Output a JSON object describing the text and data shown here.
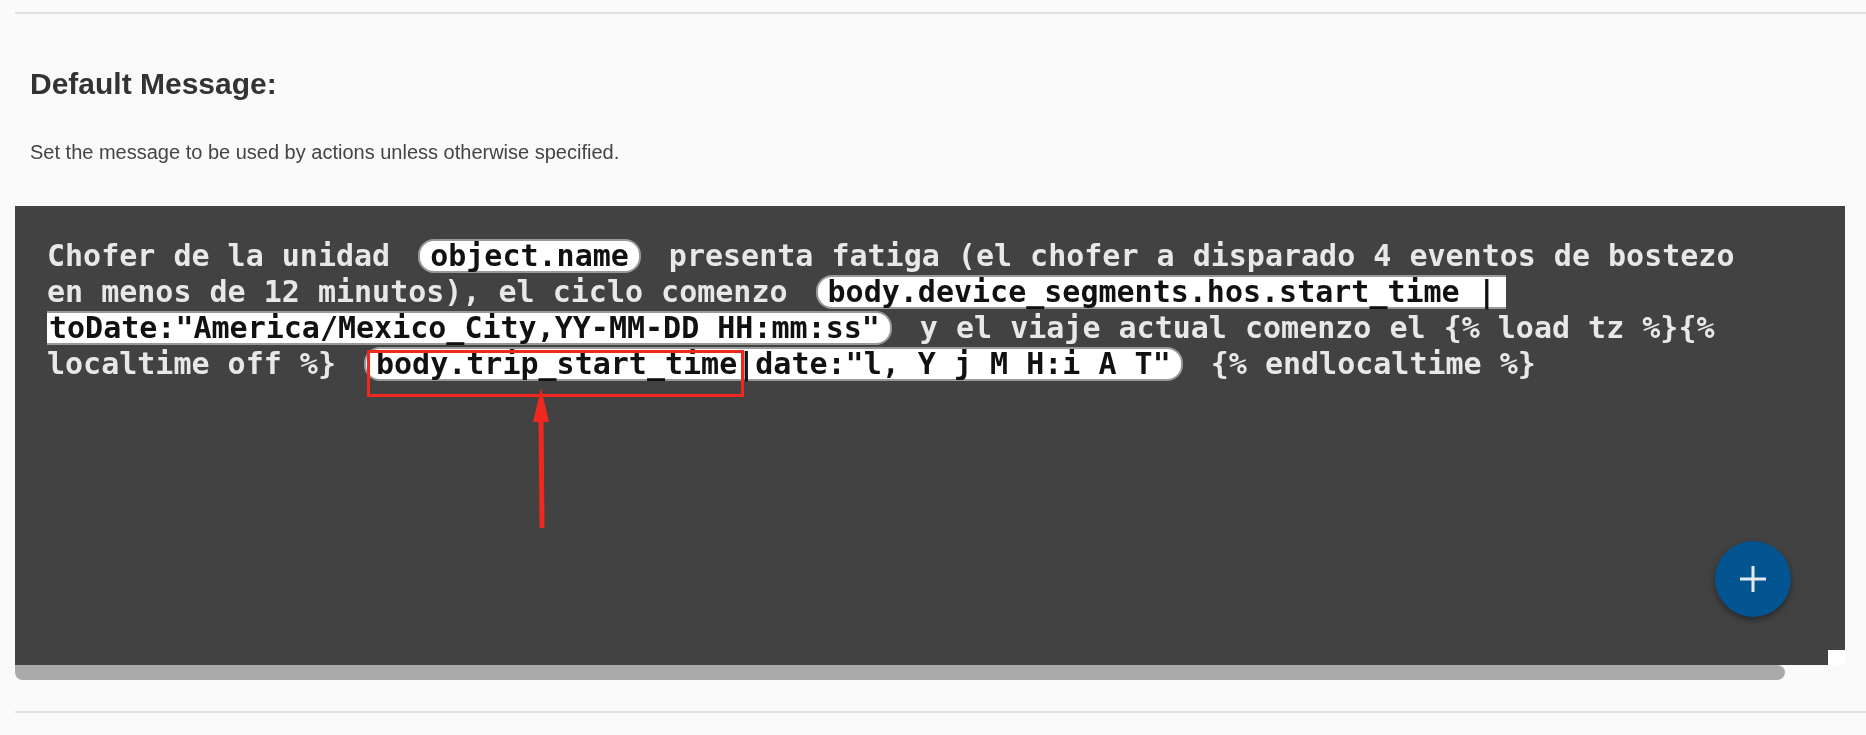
{
  "section": {
    "title": "Default Message:",
    "description": "Set the message to be used by actions unless otherwise specified."
  },
  "editor": {
    "lines": [
      {
        "segments": [
          {
            "kind": "text",
            "text": "Chofer de la unidad"
          },
          {
            "kind": "chip",
            "text": "object.name"
          },
          {
            "kind": "text",
            "text": "presenta fatiga (el chofer a disparado 4 eventos de bostezo"
          }
        ]
      },
      {
        "segments": [
          {
            "kind": "text",
            "text": "en menos de 12 minutos), el ciclo comenzo"
          },
          {
            "kind": "chip-start",
            "text": "body.device_segments.hos.start_time |"
          }
        ]
      },
      {
        "segments": [
          {
            "kind": "chip-end",
            "text": "toDate:\"America/Mexico_City,YY-MM-DD HH:mm:ss\""
          },
          {
            "kind": "text",
            "text": "y el viaje actual comenzo el {% load tz %}{%"
          }
        ]
      },
      {
        "segments": [
          {
            "kind": "text",
            "text": "localtime off %}"
          },
          {
            "kind": "chip",
            "text": "body.trip_start_time|date:\"l, Y j M H:i A T\""
          },
          {
            "kind": "text",
            "text": "{% endlocaltime %}"
          }
        ]
      }
    ]
  },
  "annotations": {
    "highlight": true,
    "arrow": true
  }
}
